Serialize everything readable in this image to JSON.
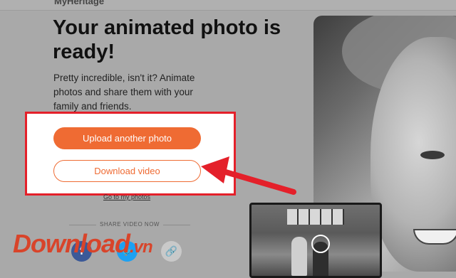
{
  "header": {
    "logo_fragment": "MyHeritage"
  },
  "result": {
    "headline": "Your animated photo is ready!",
    "description": "Pretty incredible, isn't it? Animate photos and share them with your family and friends."
  },
  "actions": {
    "upload_label": "Upload another photo",
    "download_label": "Download video",
    "gallery_link": "Go to my photos"
  },
  "share": {
    "label": "SHARE VIDEO NOW",
    "facebook_glyph": "f",
    "twitter_glyph": "🐦",
    "link_glyph": "🔗"
  },
  "watermark": {
    "main": "Download",
    "suffix": ".vn"
  },
  "colors": {
    "accent": "#ef6b33",
    "highlight": "#e4202a"
  }
}
